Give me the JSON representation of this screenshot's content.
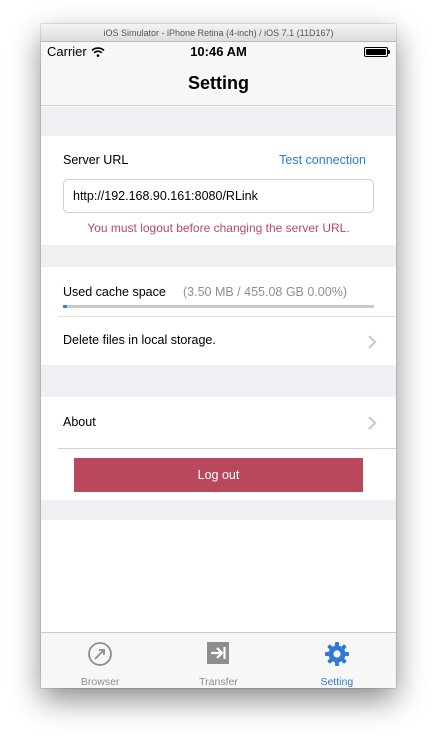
{
  "window": {
    "title": "iOS Simulator - iPhone Retina (4-inch) / iOS 7.1 (11D167)"
  },
  "status_bar": {
    "carrier": "Carrier",
    "time": "10:46 AM",
    "battery_level": 1.0
  },
  "nav": {
    "title": "Setting"
  },
  "server": {
    "label": "Server URL",
    "test_link": "Test connection",
    "url_value": "http://192.168.90.161:8080/RLink",
    "warning": "You must logout before changing the server URL."
  },
  "cache": {
    "label": "Used cache space",
    "value": "(3.50 MB / 455.08 GB 0.00%)",
    "progress_percent": 1.3
  },
  "delete_row": {
    "label": "Delete files in local storage."
  },
  "about_row": {
    "label": "About"
  },
  "logout": {
    "label": "Log out"
  },
  "tabs": [
    {
      "label": "Browser",
      "icon": "compass-icon"
    },
    {
      "label": "Transfer",
      "icon": "arrow-right-box-icon"
    },
    {
      "label": "Setting",
      "icon": "gear-icon"
    }
  ],
  "colors": {
    "accent": "#2e7bd6",
    "logout_button": "#b9485d",
    "warning_text": "#b54a63",
    "group_background": "#efeff4"
  }
}
